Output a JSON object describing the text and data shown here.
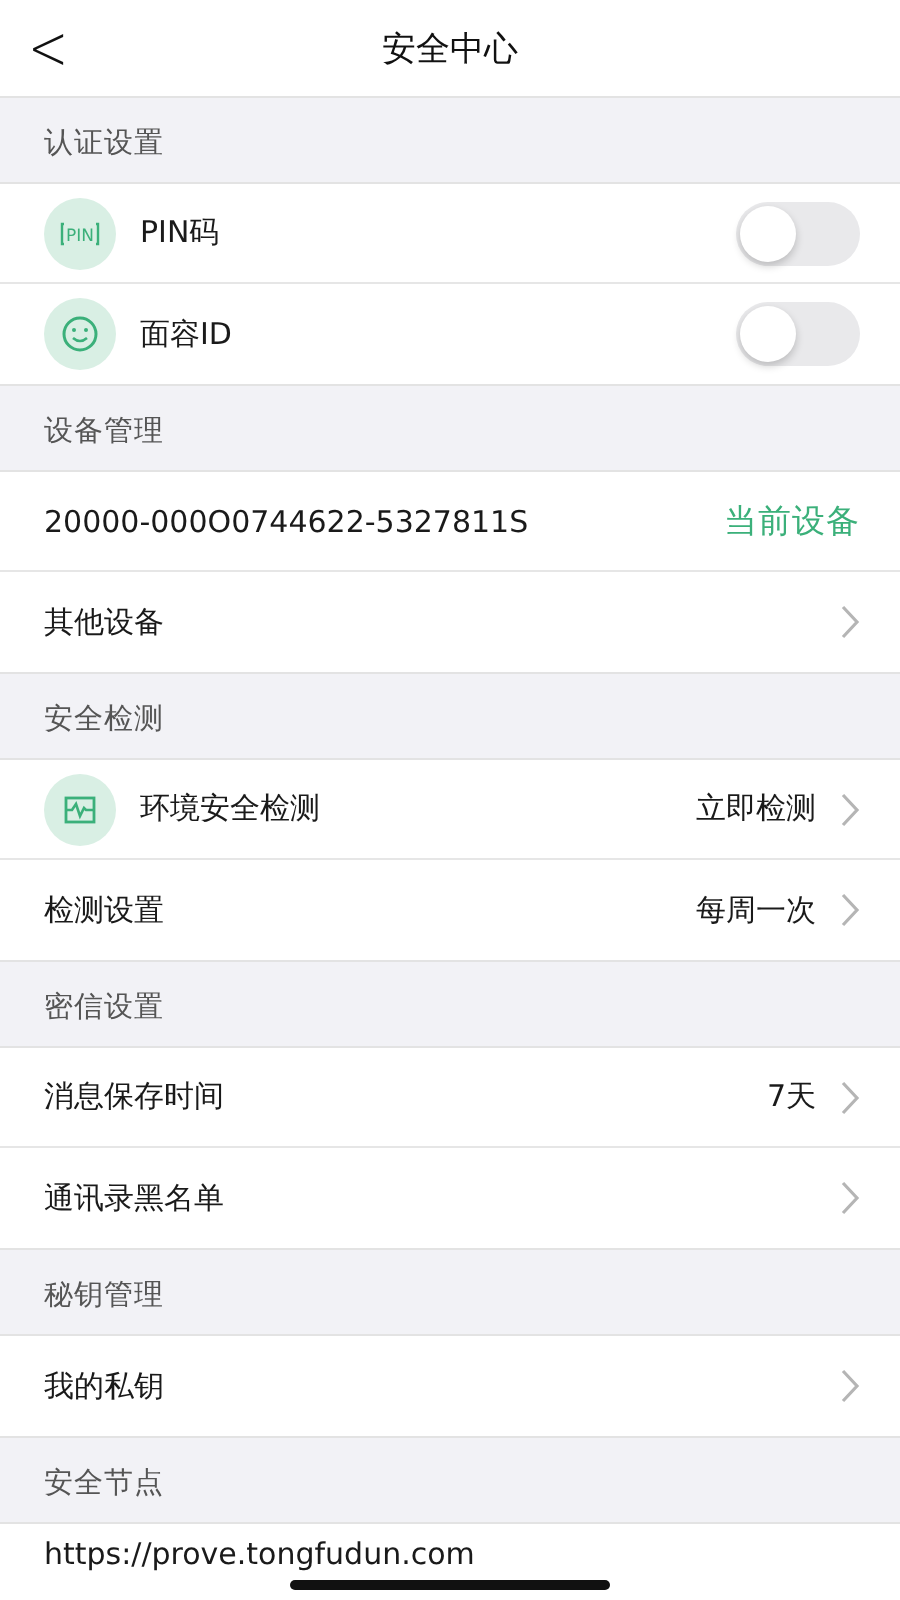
{
  "nav": {
    "back": "<",
    "title": "安全中心"
  },
  "sections": [
    {
      "title": "认证设置",
      "rows": [
        {
          "kind": "toggle",
          "icon_text": "PIN",
          "label": "PIN码",
          "on": false
        },
        {
          "kind": "toggle",
          "label": "面容ID",
          "on": false
        }
      ]
    },
    {
      "title": "设备管理",
      "rows": [
        {
          "kind": "status",
          "label": "20000-000O0744622-5327811S",
          "value": "当前设备"
        },
        {
          "kind": "link",
          "label": "其他设备"
        }
      ]
    },
    {
      "title": "安全检测",
      "rows": [
        {
          "kind": "link",
          "label": "环境安全检测",
          "value": "立即检测"
        },
        {
          "kind": "link",
          "label": "检测设置",
          "value": "每周一次"
        }
      ]
    },
    {
      "title": "密信设置",
      "rows": [
        {
          "kind": "link",
          "label": "消息保存时间",
          "value": "7天"
        },
        {
          "kind": "link",
          "label": "通讯录黑名单"
        }
      ]
    },
    {
      "title": "秘钥管理",
      "rows": [
        {
          "kind": "link",
          "label": "我的私钥"
        }
      ]
    },
    {
      "title": "安全节点",
      "rows": [
        {
          "kind": "plain",
          "label": "https://prove.tongfudun.com"
        }
      ]
    }
  ]
}
